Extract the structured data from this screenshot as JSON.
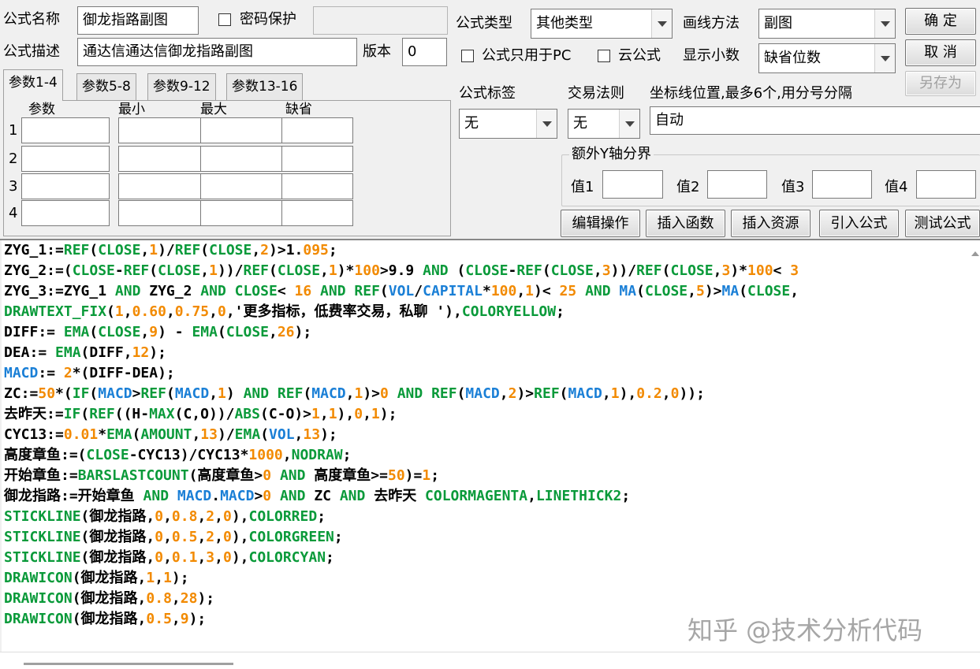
{
  "form": {
    "name_label": "公式名称",
    "name_value": "御龙指路副图",
    "password_label": "密码保护",
    "password_value": "",
    "desc_label": "公式描述",
    "desc_value": "通达信通达信御龙指路副图",
    "version_label": "版本",
    "version_value": "0"
  },
  "options": {
    "type_label": "公式类型",
    "type_value": "其他类型",
    "draw_label": "画线方法",
    "draw_value": "副图",
    "pc_only_label": "公式只用于PC",
    "cloud_label": "云公式",
    "decimals_label": "显示小数",
    "decimals_value": "缺省位数",
    "tag_label": "公式标签",
    "tag_value": "无",
    "rule_label": "交易法则",
    "rule_value": "无",
    "coord_label": "坐标线位置,最多6个,用分号分隔",
    "coord_value": "自动",
    "yaxis_label": "额外Y轴分界",
    "v1": "值1",
    "v2": "值2",
    "v3": "值3",
    "v4": "值4"
  },
  "buttons": {
    "ok": "确  定",
    "cancel": "取  消",
    "save_as": "另存为",
    "edit": "编辑操作",
    "insert_func": "插入函数",
    "insert_res": "插入资源",
    "import": "引入公式",
    "test": "测试公式"
  },
  "tabs": [
    "参数1-4",
    "参数5-8",
    "参数9-12",
    "参数13-16"
  ],
  "params": {
    "headers": [
      "参数",
      "最小",
      "最大",
      "缺省"
    ],
    "rows": [
      "1",
      "2",
      "3",
      "4"
    ]
  },
  "code_lines": [
    [
      [
        "ZYG_1:=",
        ""
      ],
      [
        "REF",
        "g"
      ],
      [
        "(",
        ""
      ],
      [
        "CLOSE",
        "g"
      ],
      [
        ",",
        ""
      ],
      [
        "1",
        "o"
      ],
      [
        ")/",
        ""
      ],
      [
        "REF",
        "g"
      ],
      [
        "(",
        ""
      ],
      [
        "CLOSE",
        "g"
      ],
      [
        ",",
        ""
      ],
      [
        "2",
        "o"
      ],
      [
        ")>1.",
        ""
      ],
      [
        "095",
        "o"
      ],
      [
        ";",
        ""
      ]
    ],
    [
      [
        "ZYG_2:=(",
        ""
      ],
      [
        "CLOSE",
        "g"
      ],
      [
        "-",
        ""
      ],
      [
        "REF",
        "g"
      ],
      [
        "(",
        ""
      ],
      [
        "CLOSE",
        "g"
      ],
      [
        ",",
        ""
      ],
      [
        "1",
        "o"
      ],
      [
        "))/",
        ""
      ],
      [
        "REF",
        "g"
      ],
      [
        "(",
        ""
      ],
      [
        "CLOSE",
        "g"
      ],
      [
        ",",
        ""
      ],
      [
        "1",
        "o"
      ],
      [
        ")*",
        ""
      ],
      [
        "100",
        "o"
      ],
      [
        ">9.9 ",
        ""
      ],
      [
        "AND",
        "g"
      ],
      [
        " (",
        ""
      ],
      [
        "CLOSE",
        "g"
      ],
      [
        "-",
        ""
      ],
      [
        "REF",
        "g"
      ],
      [
        "(",
        ""
      ],
      [
        "CLOSE",
        "g"
      ],
      [
        ",",
        ""
      ],
      [
        "3",
        "o"
      ],
      [
        "))/",
        ""
      ],
      [
        "REF",
        "g"
      ],
      [
        "(",
        ""
      ],
      [
        "CLOSE",
        "g"
      ],
      [
        ",",
        ""
      ],
      [
        "3",
        "o"
      ],
      [
        ")*",
        ""
      ],
      [
        "100",
        "o"
      ],
      [
        "< ",
        ""
      ],
      [
        "3",
        "o"
      ]
    ],
    [
      [
        "ZYG_3:=ZYG_1 ",
        ""
      ],
      [
        "AND",
        "g"
      ],
      [
        " ZYG_2 ",
        ""
      ],
      [
        "AND",
        "g"
      ],
      [
        " ",
        ""
      ],
      [
        "CLOSE",
        "g"
      ],
      [
        "< ",
        ""
      ],
      [
        "16",
        "o"
      ],
      [
        " ",
        ""
      ],
      [
        "AND",
        "g"
      ],
      [
        " ",
        ""
      ],
      [
        "REF",
        "g"
      ],
      [
        "(",
        ""
      ],
      [
        "VOL",
        "b"
      ],
      [
        "/",
        ""
      ],
      [
        "CAPITAL",
        "b"
      ],
      [
        "*",
        ""
      ],
      [
        "100",
        "o"
      ],
      [
        ",",
        ""
      ],
      [
        "1",
        "o"
      ],
      [
        ")< ",
        ""
      ],
      [
        "25",
        "o"
      ],
      [
        " ",
        ""
      ],
      [
        "AND",
        "g"
      ],
      [
        " ",
        ""
      ],
      [
        "MA",
        "b"
      ],
      [
        "(",
        ""
      ],
      [
        "CLOSE",
        "g"
      ],
      [
        ",",
        ""
      ],
      [
        "5",
        "o"
      ],
      [
        ")>",
        ""
      ],
      [
        "MA",
        "b"
      ],
      [
        "(",
        ""
      ],
      [
        "CLOSE",
        "g"
      ],
      [
        ",",
        ""
      ]
    ],
    [
      [
        "DRAWTEXT_FIX",
        "g"
      ],
      [
        "(",
        ""
      ],
      [
        "1",
        "o"
      ],
      [
        ",",
        ""
      ],
      [
        "0.60",
        "o"
      ],
      [
        ",",
        ""
      ],
      [
        "0.75",
        "o"
      ],
      [
        ",",
        ""
      ],
      [
        "0",
        "o"
      ],
      [
        ",'更多指标，低费率交易，私聊 '),",
        ""
      ],
      [
        "COLORYELLOW",
        "g"
      ],
      [
        ";",
        ""
      ]
    ],
    [
      [
        "DIFF:= ",
        ""
      ],
      [
        "EMA",
        "g"
      ],
      [
        "(",
        ""
      ],
      [
        "CLOSE",
        "g"
      ],
      [
        ",",
        ""
      ],
      [
        "9",
        "o"
      ],
      [
        ") - ",
        ""
      ],
      [
        "EMA",
        "g"
      ],
      [
        "(",
        ""
      ],
      [
        "CLOSE",
        "g"
      ],
      [
        ",",
        ""
      ],
      [
        "26",
        "o"
      ],
      [
        ");",
        ""
      ]
    ],
    [
      [
        "DEA:= ",
        ""
      ],
      [
        "EMA",
        "g"
      ],
      [
        "(DIFF,",
        ""
      ],
      [
        "12",
        "o"
      ],
      [
        ");",
        ""
      ]
    ],
    [
      [
        "MACD",
        "b"
      ],
      [
        ":= ",
        ""
      ],
      [
        "2",
        "o"
      ],
      [
        "*(DIFF-DEA);",
        ""
      ]
    ],
    [
      [
        "ZC:=",
        ""
      ],
      [
        "50",
        "o"
      ],
      [
        "*(",
        ""
      ],
      [
        "IF",
        "g"
      ],
      [
        "(",
        ""
      ],
      [
        "MACD",
        "b"
      ],
      [
        ">",
        ""
      ],
      [
        "REF",
        "g"
      ],
      [
        "(",
        ""
      ],
      [
        "MACD",
        "b"
      ],
      [
        ",",
        ""
      ],
      [
        "1",
        "o"
      ],
      [
        ") ",
        ""
      ],
      [
        "AND",
        "g"
      ],
      [
        " ",
        ""
      ],
      [
        "REF",
        "g"
      ],
      [
        "(",
        ""
      ],
      [
        "MACD",
        "b"
      ],
      [
        ",",
        ""
      ],
      [
        "1",
        "o"
      ],
      [
        ")>",
        ""
      ],
      [
        "0",
        "o"
      ],
      [
        " ",
        ""
      ],
      [
        "AND",
        "g"
      ],
      [
        " ",
        ""
      ],
      [
        "REF",
        "g"
      ],
      [
        "(",
        ""
      ],
      [
        "MACD",
        "b"
      ],
      [
        ",",
        ""
      ],
      [
        "2",
        "o"
      ],
      [
        ")>",
        ""
      ],
      [
        "REF",
        "g"
      ],
      [
        "(",
        ""
      ],
      [
        "MACD",
        "b"
      ],
      [
        ",",
        ""
      ],
      [
        "1",
        "o"
      ],
      [
        "),",
        ""
      ],
      [
        "0.2",
        "o"
      ],
      [
        ",",
        ""
      ],
      [
        "0",
        "o"
      ],
      [
        "));",
        ""
      ]
    ],
    [
      [
        "去昨天:=",
        ""
      ],
      [
        "IF",
        "g"
      ],
      [
        "(",
        ""
      ],
      [
        "REF",
        "g"
      ],
      [
        "((H-",
        ""
      ],
      [
        "MAX",
        "g"
      ],
      [
        "(C,O))/",
        ""
      ],
      [
        "ABS",
        "g"
      ],
      [
        "(C-O)>",
        ""
      ],
      [
        "1",
        "o"
      ],
      [
        ",",
        ""
      ],
      [
        "1",
        "o"
      ],
      [
        "),",
        ""
      ],
      [
        "0",
        "o"
      ],
      [
        ",",
        ""
      ],
      [
        "1",
        "o"
      ],
      [
        ");",
        ""
      ]
    ],
    [
      [
        "CYC13:=",
        ""
      ],
      [
        "0.01",
        "o"
      ],
      [
        "*",
        ""
      ],
      [
        "EMA",
        "g"
      ],
      [
        "(",
        ""
      ],
      [
        "AMOUNT",
        "g"
      ],
      [
        ",",
        ""
      ],
      [
        "13",
        "o"
      ],
      [
        ")/",
        ""
      ],
      [
        "EMA",
        "g"
      ],
      [
        "(",
        ""
      ],
      [
        "VOL",
        "b"
      ],
      [
        ",",
        ""
      ],
      [
        "13",
        "o"
      ],
      [
        ");",
        ""
      ]
    ],
    [
      [
        "高度章鱼:=(",
        ""
      ],
      [
        "CLOSE",
        "g"
      ],
      [
        "-CYC13)/CYC13*",
        ""
      ],
      [
        "1000",
        "o"
      ],
      [
        ",",
        ""
      ],
      [
        "NODRAW",
        "g"
      ],
      [
        ";",
        ""
      ]
    ],
    [
      [
        "开始章鱼:=",
        ""
      ],
      [
        "BARSLASTCOUNT",
        "g"
      ],
      [
        "(高度章鱼>",
        ""
      ],
      [
        "0",
        "o"
      ],
      [
        " ",
        ""
      ],
      [
        "AND",
        "g"
      ],
      [
        " 高度章鱼>=",
        ""
      ],
      [
        "50",
        "o"
      ],
      [
        ")=",
        ""
      ],
      [
        "1",
        "o"
      ],
      [
        ";",
        ""
      ]
    ],
    [
      [
        "御龙指路:=开始章鱼 ",
        ""
      ],
      [
        "AND",
        "g"
      ],
      [
        " ",
        ""
      ],
      [
        "MACD",
        "b"
      ],
      [
        ".",
        ""
      ],
      [
        "MACD",
        "b"
      ],
      [
        ">",
        ""
      ],
      [
        "0",
        "o"
      ],
      [
        " ",
        ""
      ],
      [
        "AND",
        "g"
      ],
      [
        " ZC ",
        ""
      ],
      [
        "AND",
        "g"
      ],
      [
        " 去昨天 ",
        ""
      ],
      [
        "COLORMAGENTA",
        "g"
      ],
      [
        ",",
        ""
      ],
      [
        "LINETHICK2",
        "g"
      ],
      [
        ";",
        ""
      ]
    ],
    [
      [
        "STICKLINE",
        "g"
      ],
      [
        "(御龙指路,",
        ""
      ],
      [
        "0",
        "o"
      ],
      [
        ",",
        ""
      ],
      [
        "0.8",
        "o"
      ],
      [
        ",",
        ""
      ],
      [
        "2",
        "o"
      ],
      [
        ",",
        ""
      ],
      [
        "0",
        "o"
      ],
      [
        "),",
        ""
      ],
      [
        "COLORRED",
        "g"
      ],
      [
        ";",
        ""
      ]
    ],
    [
      [
        "STICKLINE",
        "g"
      ],
      [
        "(御龙指路,",
        ""
      ],
      [
        "0",
        "o"
      ],
      [
        ",",
        ""
      ],
      [
        "0.5",
        "o"
      ],
      [
        ",",
        ""
      ],
      [
        "2",
        "o"
      ],
      [
        ",",
        ""
      ],
      [
        "0",
        "o"
      ],
      [
        "),",
        ""
      ],
      [
        "COLORGREEN",
        "g"
      ],
      [
        ";",
        ""
      ]
    ],
    [
      [
        "STICKLINE",
        "g"
      ],
      [
        "(御龙指路,",
        ""
      ],
      [
        "0",
        "o"
      ],
      [
        ",",
        ""
      ],
      [
        "0.1",
        "o"
      ],
      [
        ",",
        ""
      ],
      [
        "3",
        "o"
      ],
      [
        ",",
        ""
      ],
      [
        "0",
        "o"
      ],
      [
        "),",
        ""
      ],
      [
        "COLORCYAN",
        "g"
      ],
      [
        ";",
        ""
      ]
    ],
    [
      [
        "DRAWICON",
        "g"
      ],
      [
        "(御龙指路,",
        ""
      ],
      [
        "1",
        "o"
      ],
      [
        ",",
        ""
      ],
      [
        "1",
        "o"
      ],
      [
        ");",
        ""
      ]
    ],
    [
      [
        "DRAWICON",
        "g"
      ],
      [
        "(御龙指路,",
        ""
      ],
      [
        "0.8",
        "o"
      ],
      [
        ",",
        ""
      ],
      [
        "28",
        "o"
      ],
      [
        ");",
        ""
      ]
    ],
    [
      [
        "DRAWICON",
        "g"
      ],
      [
        "(御龙指路,",
        ""
      ],
      [
        "0.5",
        "o"
      ],
      [
        ",",
        ""
      ],
      [
        "9",
        "o"
      ],
      [
        ");",
        ""
      ]
    ]
  ],
  "colors": {
    "g": "#0a9a3a",
    "o": "#f28a00",
    "b": "#1a7fd6",
    "default": "#000000"
  },
  "watermark": "知乎 @技术分析代码"
}
